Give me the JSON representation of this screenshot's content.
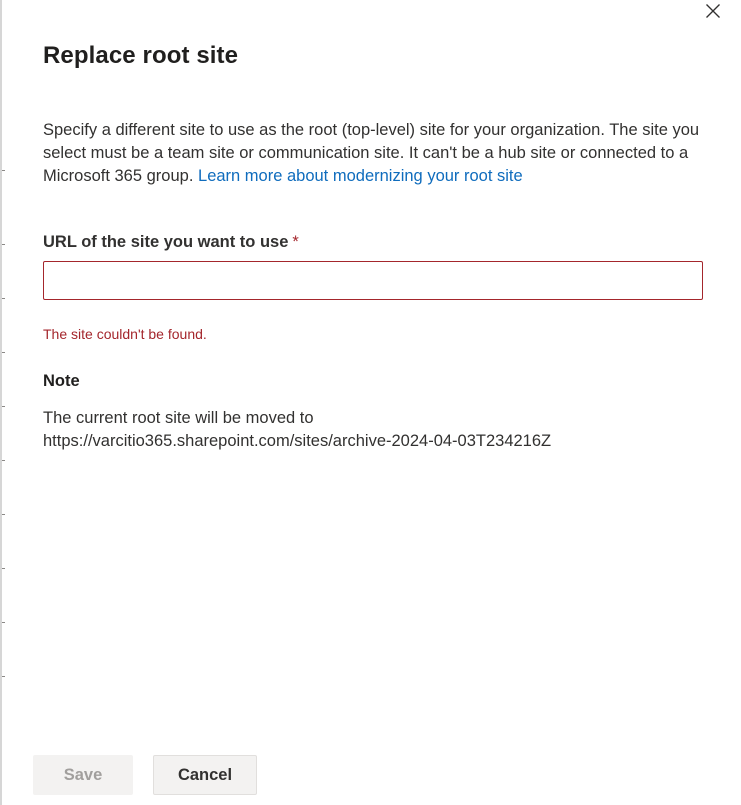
{
  "dialog": {
    "title": "Replace root site",
    "close_icon": "close-icon",
    "description": "Specify a different site to use as the root (top-level) site for your organization. The site you select must be a team site or communication site. It can't be a hub site or connected to a Microsoft 365 group.",
    "learn_more_link": "Learn more about modernizing your root site"
  },
  "url_field": {
    "label": "URL of the site you want to use",
    "required_marker": "*",
    "value": "",
    "placeholder": "",
    "error": "The site couldn't be found."
  },
  "note": {
    "heading": "Note",
    "line1": "The current root site will be moved to",
    "line2": "https://varcitio365.sharepoint.com/sites/archive-2024-04-03T234216Z"
  },
  "footer": {
    "save_label": "Save",
    "save_enabled": false,
    "cancel_label": "Cancel"
  },
  "colors": {
    "link": "#0f6cbd",
    "error": "#a4262c",
    "text": "#323130",
    "button_bg": "#f3f2f1"
  }
}
